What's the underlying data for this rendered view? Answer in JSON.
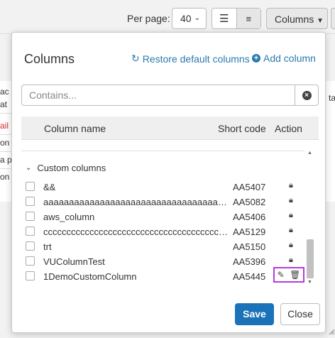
{
  "toolbar": {
    "per_page_label": "Per page:",
    "per_page_value": "40",
    "view_list_icon": "list-icon",
    "view_compact_icon": "compact-list-icon",
    "columns_label": "Columns"
  },
  "background_table": {
    "fragments": [
      "ac",
      "at",
      "ail",
      "on",
      "a p",
      "on"
    ],
    "right_fragment": "ta"
  },
  "modal": {
    "title": "Columns",
    "restore_label": "Restore default columns",
    "add_label": "Add column",
    "search_placeholder": "Contains...",
    "headers": {
      "name": "Column name",
      "code": "Short code",
      "action": "Action"
    },
    "group_label": "Custom columns",
    "rows": [
      {
        "name": "&&",
        "code": "AA5407",
        "locked": true
      },
      {
        "name": "aaaaaaaaaaaaaaaaaaaaaaaaaaaaaaaaaaaaaaaaaaaaaaaaa",
        "code": "AA5082",
        "locked": true
      },
      {
        "name": "aws_column",
        "code": "AA5406",
        "locked": true
      },
      {
        "name": "cccccccccccccccccccccccccccccccccccccccccccccc",
        "code": "AA5129",
        "locked": true
      },
      {
        "name": "trt",
        "code": "AA5150",
        "locked": true
      },
      {
        "name": "VUColumnTest",
        "code": "AA5396",
        "locked": true
      },
      {
        "name": "1DemoCustomColumn",
        "code": "AA5445",
        "locked": false
      }
    ],
    "save_label": "Save",
    "close_label": "Close"
  },
  "colors": {
    "accent": "#1a73b9",
    "link": "#2a7ab0",
    "highlight": "#b43be0"
  }
}
